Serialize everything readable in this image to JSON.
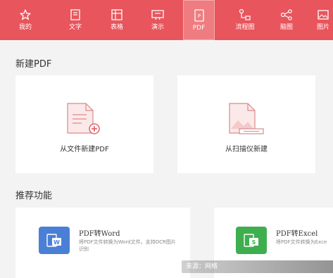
{
  "toolbar": {
    "items": [
      {
        "label": "我的",
        "icon": "star-icon"
      },
      {
        "label": "文字",
        "icon": "document-icon"
      },
      {
        "label": "表格",
        "icon": "table-icon"
      },
      {
        "label": "演示",
        "icon": "presentation-icon"
      },
      {
        "label": "PDF",
        "icon": "pdf-icon",
        "active": true
      },
      {
        "label": "流程图",
        "icon": "flowchart-icon"
      },
      {
        "label": "脑图",
        "icon": "mindmap-icon"
      },
      {
        "label": "图片",
        "icon": "image-icon"
      }
    ],
    "background": "#e8555c"
  },
  "new_pdf": {
    "title": "新建PDF",
    "cards": [
      {
        "label": "从文件新建PDF",
        "icon": "file-add-icon"
      },
      {
        "label": "从扫描仪新建",
        "icon": "scanner-icon"
      }
    ]
  },
  "recommended": {
    "title": "推荐功能",
    "items": [
      {
        "title": "PDF转Word",
        "desc": "将PDF文件转换为Word文件，支持OCR图片识别",
        "icon": "word-icon",
        "color": "#4a7fd6"
      },
      {
        "title": "PDF转Excel",
        "desc": "将PDF文件转换为Exce",
        "icon": "excel-icon",
        "color": "#3fae4f"
      }
    ]
  },
  "watermark": "来源：网络"
}
